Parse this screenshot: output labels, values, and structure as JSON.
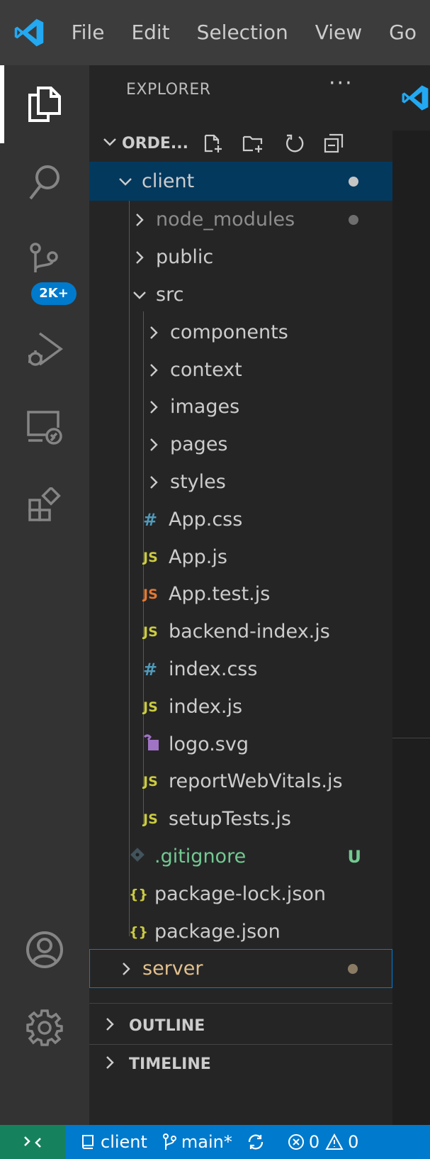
{
  "menu": [
    "File",
    "Edit",
    "Selection",
    "View",
    "Go"
  ],
  "activity_bar": {
    "scm_badge": "2K+"
  },
  "explorer": {
    "title": "EXPLORER",
    "more": "···",
    "workspace": "ORDE...",
    "tree": [
      {
        "label": "client",
        "kind": "folder",
        "expanded": true,
        "selected": true,
        "deco": "dot"
      },
      {
        "label": "node_modules",
        "kind": "folder",
        "expanded": false,
        "dim": true,
        "deco": "dot-gray"
      },
      {
        "label": "public",
        "kind": "folder",
        "expanded": false
      },
      {
        "label": "src",
        "kind": "folder",
        "expanded": true
      },
      {
        "label": "components",
        "kind": "folder",
        "expanded": false
      },
      {
        "label": "context",
        "kind": "folder",
        "expanded": false
      },
      {
        "label": "images",
        "kind": "folder",
        "expanded": false
      },
      {
        "label": "pages",
        "kind": "folder",
        "expanded": false
      },
      {
        "label": "styles",
        "kind": "folder",
        "expanded": false
      },
      {
        "label": "App.css",
        "kind": "file",
        "icon": "#"
      },
      {
        "label": "App.js",
        "kind": "file",
        "icon": "JS"
      },
      {
        "label": "App.test.js",
        "kind": "file",
        "icon": "JS"
      },
      {
        "label": "backend-index.js",
        "kind": "file",
        "icon": "JS"
      },
      {
        "label": "index.css",
        "kind": "file",
        "icon": "#"
      },
      {
        "label": "index.js",
        "kind": "file",
        "icon": "JS"
      },
      {
        "label": "logo.svg",
        "kind": "file",
        "icon": "svg-icon"
      },
      {
        "label": "reportWebVitals.js",
        "kind": "file",
        "icon": "JS"
      },
      {
        "label": "setupTests.js",
        "kind": "file",
        "icon": "JS"
      },
      {
        "label": ".gitignore",
        "kind": "file",
        "icon": "git-icon",
        "deco": "U"
      },
      {
        "label": "package-lock.json",
        "kind": "file",
        "icon": "{}"
      },
      {
        "label": "package.json",
        "kind": "file",
        "icon": "{}"
      },
      {
        "label": "server",
        "kind": "folder",
        "expanded": false,
        "focused": true,
        "deco": "dot-brown"
      }
    ],
    "outline": "OUTLINE",
    "timeline": "TIMELINE"
  },
  "status": {
    "folder": "client",
    "branch": "main*",
    "errors": "0",
    "warnings": "0"
  },
  "colors": {
    "accent": "#007acc",
    "remote": "#16825d",
    "js_yellow": "#cbcb41",
    "js_orange": "#e37933",
    "css_blue": "#519aba",
    "json_yellow": "#cbcb41",
    "untracked_green": "#73c991",
    "svg_purple": "#a074c4",
    "folder_modified": "#8b7b65"
  }
}
